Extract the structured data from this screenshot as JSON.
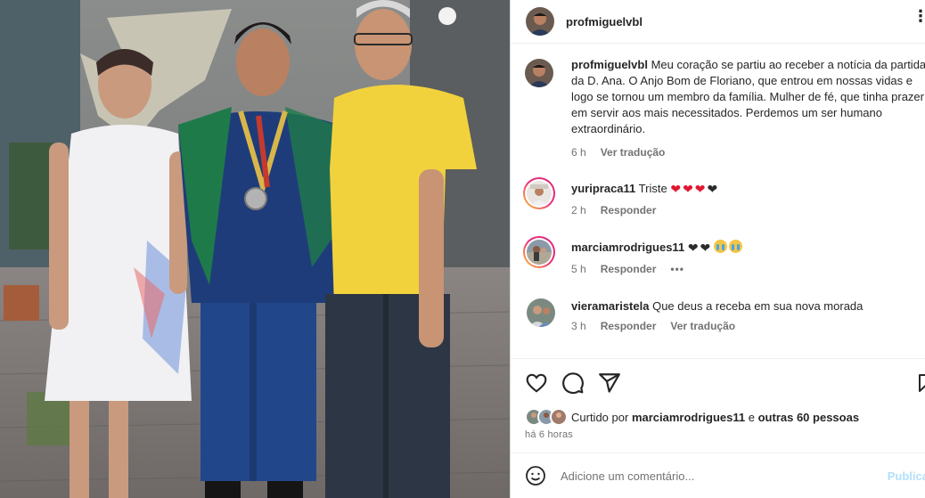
{
  "post": {
    "author": "profmiguelvbl",
    "more_icon": "more-horizontal-icon",
    "photo_alt": "",
    "caption": {
      "user": "profmiguelvbl",
      "text": "Meu coração se partiu ao receber a notícia da partida da D. Ana. O Anjo Bom de Floriano, que entrou em nossas vidas e logo se tornou um membro da família. Mulher de fé, que tinha prazer em servir aos mais necessitados. Perdemos um ser humano extraordinário.",
      "time": "6 h",
      "translate": "Ver tradução"
    },
    "comments": [
      {
        "user": "yuripraca11",
        "text": "Triste",
        "emoji": [
          "red-heart",
          "red-heart",
          "red-heart",
          "black-heart"
        ],
        "time": "2 h",
        "reply": "Responder"
      },
      {
        "user": "marciamrodrigues11",
        "text": "",
        "emoji": [
          "black-heart",
          "black-heart",
          "crying-face",
          "crying-face"
        ],
        "time": "5 h",
        "reply": "Responder",
        "more": "•••"
      },
      {
        "user": "vieramaristela",
        "text": "Que deus a receba em sua nova morada",
        "time": "3 h",
        "reply": "Responder",
        "translate": "Ver tradução"
      }
    ],
    "likes": {
      "prefix": "Curtido por",
      "user": "marciamrodrigues11",
      "conj": "e",
      "others": "outras 60 pessoas"
    },
    "posted": "há 6 horas",
    "add_comment": {
      "placeholder": "Adicione um comentário...",
      "button": "Publicar"
    },
    "colors": {
      "like_blue": "#b2dffc",
      "shirt_yellow": "#f2d23c",
      "heart_red": "#e0182e"
    }
  }
}
